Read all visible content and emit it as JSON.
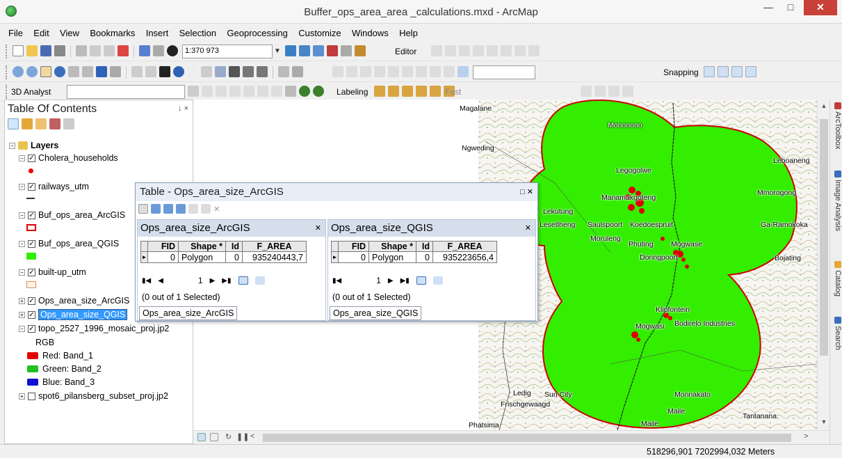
{
  "window": {
    "title": "Buffer_ops_area_area _calculations.mxd - ArcMap"
  },
  "menu": [
    "File",
    "Edit",
    "View",
    "Bookmarks",
    "Insert",
    "Selection",
    "Geoprocessing",
    "Customize",
    "Windows",
    "Help"
  ],
  "toolbar": {
    "scale": "1:370 973",
    "editor_label": "Editor",
    "snapping_label": "Snapping",
    "analyst_label": "3D Analyst",
    "labeling_label": "Labeling",
    "fast_label": "Fast"
  },
  "toc": {
    "title": "Table Of Contents",
    "pin": "↓ ×",
    "layers_label": "Layers",
    "items": [
      {
        "label": "Cholera_households",
        "checked": true
      },
      {
        "label": "railways_utm",
        "checked": true
      },
      {
        "label": "Buf_ops_area_ArcGIS",
        "checked": true
      },
      {
        "label": "Buf_ops_area_QGIS",
        "checked": true
      },
      {
        "label": "built-up_utm",
        "checked": true
      },
      {
        "label": "Ops_area_size_ArcGIS",
        "checked": true
      },
      {
        "label": "Ops_area_size_QGIS",
        "checked": true,
        "selected": true
      },
      {
        "label": "topo_2527_1996_mosaic_proj.jp2",
        "checked": true
      },
      {
        "label": "spot6_pilansberg_subset_proj.jp2",
        "checked": false
      }
    ],
    "rgb_label": "RGB",
    "bands": [
      {
        "label": "Red:  Band_1",
        "color": "#e00000"
      },
      {
        "label": "Green: Band_2",
        "color": "#22c022"
      },
      {
        "label": "Blue:  Band_3",
        "color": "#1010d0"
      }
    ]
  },
  "table": {
    "title": "Table - Ops_area_size_ArcGIS",
    "panes": [
      {
        "name": "Ops_area_size_ArcGIS",
        "columns": [
          "FID",
          "Shape *",
          "Id",
          "F_AREA"
        ],
        "rows": [
          [
            "0",
            "Polygon",
            "0",
            "935240443,7"
          ]
        ],
        "nav_page": "1",
        "selection": "(0 out of 1 Selected)",
        "tab": "Ops_area_size_ArcGIS"
      },
      {
        "name": "Ops_area_size_QGIS",
        "columns": [
          "FID",
          "Shape *",
          "Id",
          "F_AREA"
        ],
        "rows": [
          [
            "0",
            "Polygon",
            "0",
            "935223656,4"
          ]
        ],
        "nav_page": "1",
        "selection": "(0 out of 1 Selected)",
        "tab": "Ops_area_size_QGIS"
      }
    ]
  },
  "map": {
    "buffer_fill": "#33ee00",
    "buffer_outline": "#cc0000",
    "places": [
      "Magalane",
      "Mononono",
      "Ngweding",
      "Leboaneng",
      "Legogolwe",
      "Mmorogong",
      "Manamakgoteng",
      "Lekutung",
      "Lesetlheng",
      "Saulspoort",
      "Koedoespruit",
      "Ga-Ramokoka",
      "Moruleng",
      "Phuting",
      "Mogwase",
      "Doringpoort",
      "Bojating",
      "Klipfontein",
      "Mogwasi",
      "Bodirelo Industries",
      "Ledig",
      "Sun City",
      "Monnakato",
      "Frischgewaagd",
      "Maile",
      "Tantanana",
      "Phatsima",
      "Maile"
    ]
  },
  "dock_tabs": [
    "ArcToolbox",
    "Image Analysis",
    "Catalog",
    "Search"
  ],
  "status": {
    "coords": "518296,901  7202994,032 Meters"
  }
}
